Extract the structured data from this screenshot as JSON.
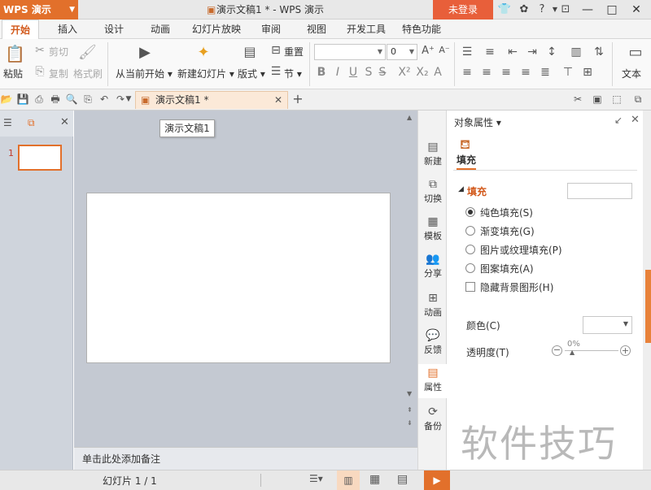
{
  "titlebar": {
    "app_name": "WPS 演示",
    "doc_title": "演示文稿1 * - WPS 演示",
    "login": "未登录"
  },
  "menu": [
    "开始",
    "插入",
    "设计",
    "动画",
    "幻灯片放映",
    "审阅",
    "视图",
    "开发工具",
    "特色功能"
  ],
  "ribbon": {
    "paste": "粘贴",
    "cut": "剪切",
    "copy": "复制",
    "format_painter": "格式刷",
    "from_current": "从当前开始",
    "new_slide": "新建幻灯片",
    "layout": "版式",
    "reset": "重置",
    "section": "节",
    "font_size": "0",
    "bold": "B",
    "italic": "I",
    "underline": "U",
    "shadow": "S",
    "text_tools": "文本"
  },
  "doc_tab": "演示文稿1 *",
  "tooltip": "演示文稿1",
  "thumbs": {
    "slide_number": "1"
  },
  "notes_placeholder": "单击此处添加备注",
  "status": {
    "slide_info": "幻灯片 1 / 1"
  },
  "side_tools": [
    "新建",
    "切换",
    "模板",
    "分享",
    "动画",
    "反馈",
    "属性",
    "备份"
  ],
  "props": {
    "title": "对象属性",
    "tab": "填充",
    "section": "填充",
    "options": [
      "纯色填充(S)",
      "渐变填充(G)",
      "图片或纹理填充(P)",
      "图案填充(A)"
    ],
    "hide_bg": "隐藏背景图形(H)",
    "color_label": "颜色(C)",
    "transparency_label": "透明度(T)",
    "transparency_value": "0%"
  },
  "watermark": "软件技巧",
  "colors": {
    "accent": "#e2702b",
    "login": "#e85f3a"
  }
}
